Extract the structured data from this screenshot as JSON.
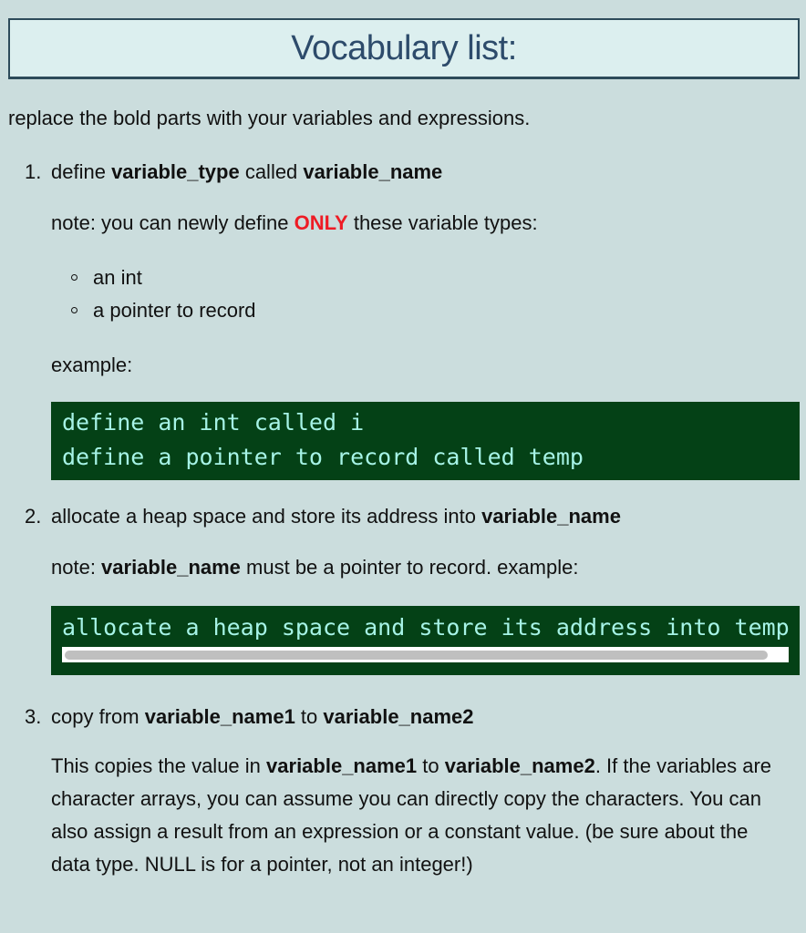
{
  "title": "Vocabulary list:",
  "intro": "replace the bold parts with your variables and expressions.",
  "steps": [
    {
      "number": "1.",
      "parts": {
        "t1": "define ",
        "b1": "variable_type",
        "t2": " called ",
        "b2": "variable_name"
      },
      "note": {
        "t1": "note: you can newly define ",
        "emph": "ONLY",
        "t2": " these variable types:"
      },
      "types": [
        "an int",
        "a pointer to record"
      ],
      "example_label": "example:",
      "code": [
        "define an int called i",
        "define a pointer to record called temp"
      ]
    },
    {
      "number": "2.",
      "parts": {
        "t1": "allocate a heap space and store its address into ",
        "b1": "variable_name"
      },
      "note": {
        "t1": "note: ",
        "b1": "variable_name",
        "t2": " must be a pointer to record. example:"
      },
      "code": [
        "allocate a heap space and store its address into temp"
      ]
    },
    {
      "number": "3.",
      "parts": {
        "t1": "copy from ",
        "b1": "variable_name1",
        "t2": " to ",
        "b2": "variable_name2"
      },
      "desc": {
        "t1": "This copies the value in ",
        "b1": "variable_name1",
        "t2": " to ",
        "b2": "variable_name2",
        "t3": ". If the variables are character arrays, you can assume you can directly copy the characters. You can also assign a result from an expression or a constant value. (be sure about the data type. NULL is for a pointer, not an integer!)"
      }
    }
  ],
  "colors": {
    "background": "#cbdddd",
    "title_box": "#dcefef",
    "title_text": "#2d4b6b",
    "emphasis_red": "#ee1c25",
    "code_bg": "#044116",
    "code_text": "#a6f3e6"
  }
}
